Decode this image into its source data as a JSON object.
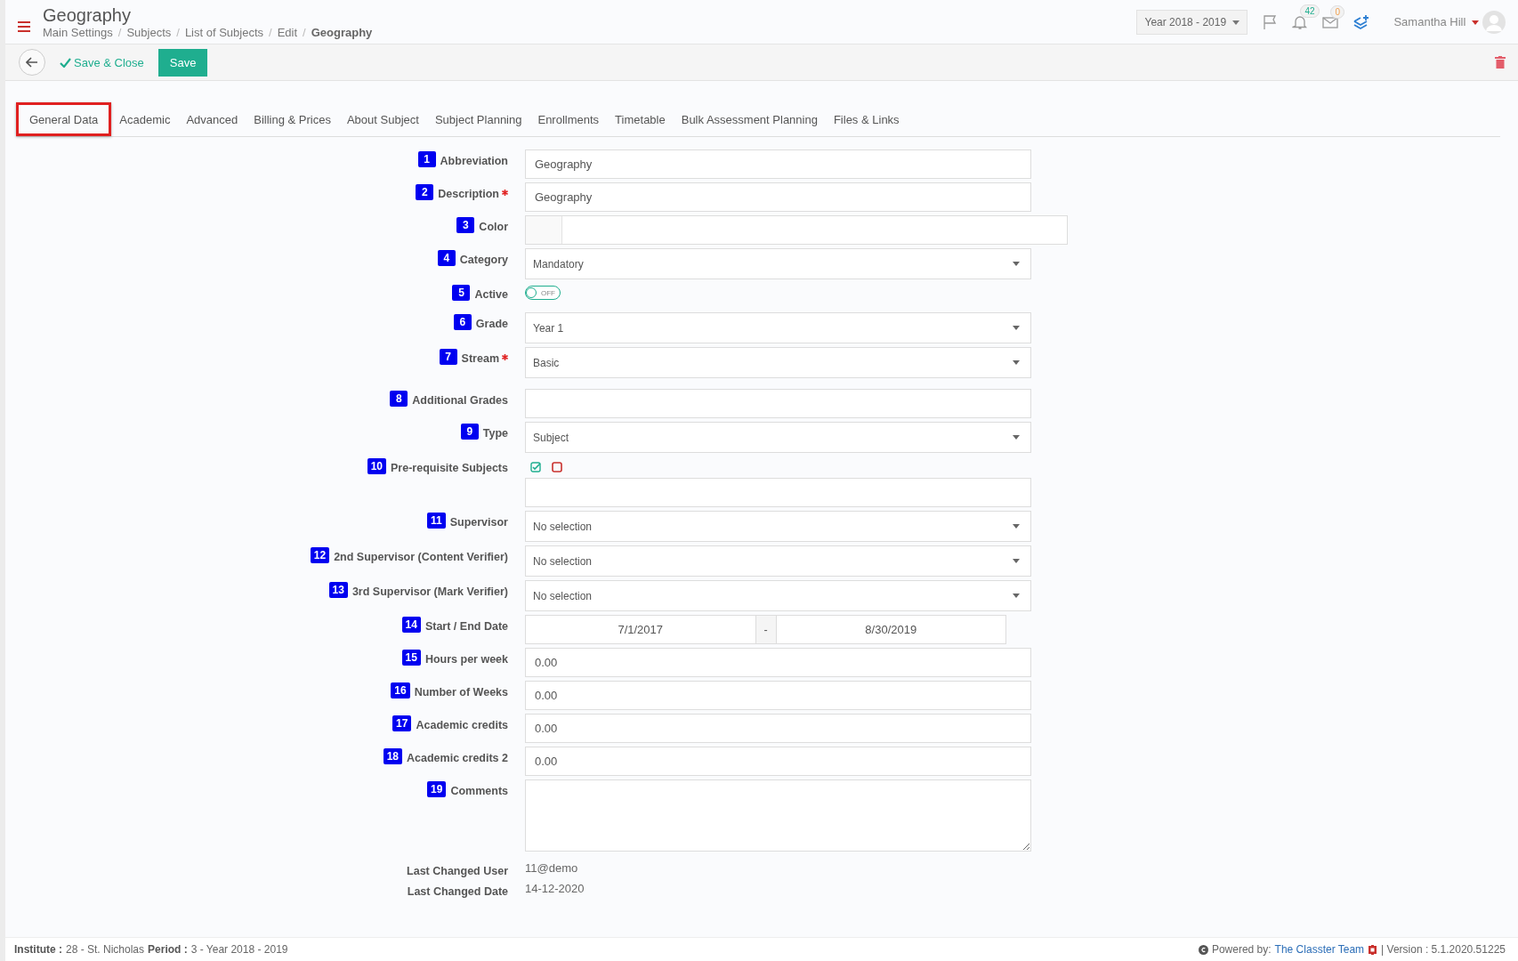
{
  "header": {
    "title": "Geography",
    "breadcrumb": [
      {
        "label": "Main Settings",
        "current": false
      },
      {
        "label": "Subjects",
        "current": false
      },
      {
        "label": "List of Subjects",
        "current": false
      },
      {
        "label": "Edit",
        "current": false
      },
      {
        "label": "Geography",
        "current": true
      }
    ],
    "separator": "/",
    "year": "Year 2018 - 2019",
    "notifications": "42",
    "messages": "0",
    "user": "Samantha Hill"
  },
  "toolbar": {
    "save_close": "Save & Close",
    "save": "Save"
  },
  "tabs": [
    {
      "label": "General Data",
      "selected": true
    },
    {
      "label": "Academic",
      "selected": false
    },
    {
      "label": "Advanced",
      "selected": false
    },
    {
      "label": "Billing & Prices",
      "selected": false
    },
    {
      "label": "About Subject",
      "selected": false
    },
    {
      "label": "Subject Planning",
      "selected": false
    },
    {
      "label": "Enrollments",
      "selected": false
    },
    {
      "label": "Timetable",
      "selected": false
    },
    {
      "label": "Bulk Assessment Planning",
      "selected": false
    },
    {
      "label": "Files & Links",
      "selected": false
    }
  ],
  "fields": [
    {
      "number": "1",
      "label": "Abbreviation",
      "required": false,
      "kind": "text",
      "value": "Geography"
    },
    {
      "number": "2",
      "label": "Description",
      "required": true,
      "kind": "text",
      "value": "Geography"
    },
    {
      "number": "3",
      "label": "Color",
      "required": false,
      "kind": "color"
    },
    {
      "number": "4",
      "label": "Category",
      "required": false,
      "kind": "select",
      "value": "Mandatory"
    },
    {
      "number": "5",
      "label": "Active",
      "required": false,
      "kind": "toggle",
      "on": false,
      "value": "OFF"
    },
    {
      "number": "6",
      "label": "Grade",
      "required": false,
      "kind": "select",
      "value": "Year 1"
    },
    {
      "number": "7",
      "label": "Stream",
      "required": true,
      "kind": "select",
      "value": "Basic"
    },
    {
      "number": "8",
      "label": "Additional Grades",
      "required": false,
      "kind": "multi"
    },
    {
      "number": "9",
      "label": "Type",
      "required": false,
      "kind": "select",
      "value": "Subject"
    },
    {
      "number": "10",
      "label": "Pre-requisite Subjects",
      "required": false,
      "kind": "checks"
    },
    {
      "number": "11",
      "label": "Supervisor",
      "required": false,
      "kind": "select",
      "value": "No selection"
    },
    {
      "number": "12",
      "label": "2nd Supervisor (Content Verifier)",
      "required": false,
      "kind": "select",
      "value": "No selection"
    },
    {
      "number": "13",
      "label": "3rd Supervisor (Mark Verifier)",
      "required": false,
      "kind": "select",
      "value": "No selection"
    },
    {
      "number": "14",
      "label": "Start / End Date",
      "required": false,
      "kind": "dates",
      "start": "7/1/2017",
      "separator": "-",
      "end": "8/30/2019"
    },
    {
      "number": "15",
      "label": "Hours per week",
      "required": false,
      "kind": "text",
      "value": "0.00"
    },
    {
      "number": "16",
      "label": "Number of Weeks",
      "required": false,
      "kind": "text",
      "value": "0.00"
    },
    {
      "number": "17",
      "label": "Academic credits",
      "required": false,
      "kind": "text",
      "value": "0.00"
    },
    {
      "number": "18",
      "label": "Academic credits 2",
      "required": false,
      "kind": "text",
      "value": "0.00"
    },
    {
      "number": "19",
      "label": "Comments",
      "required": false,
      "kind": "textarea"
    }
  ],
  "meta": [
    {
      "label": "Last Changed User",
      "value": "11@demo"
    },
    {
      "label": "Last Changed Date",
      "value": "14-12-2020"
    }
  ],
  "footer": {
    "institute_label": "Institute :",
    "institute": "28 - St. Nicholas",
    "period_label": "Period :",
    "period": "3 - Year 2018 - 2019",
    "powered": "Powered by:",
    "team": "The Classter Team",
    "version": "| Version : 5.1.2020.51225"
  }
}
